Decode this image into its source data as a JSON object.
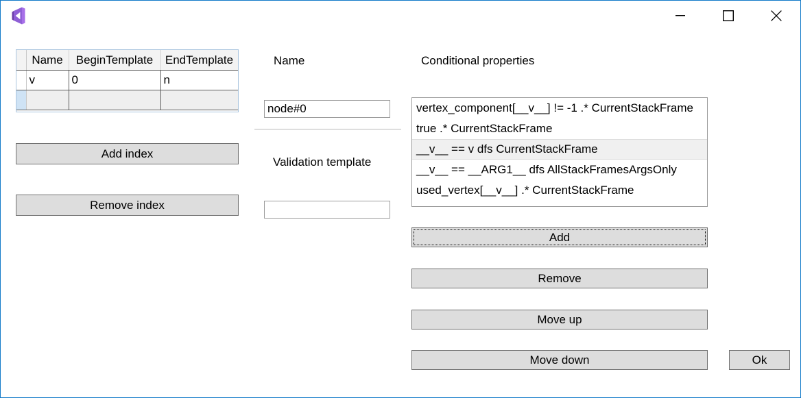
{
  "window": {
    "border_color": "#1279c8",
    "logo_icon": "visual-studio-logo-icon",
    "controls": {
      "minimize_label": "—",
      "maximize_label": "□",
      "close_label": "✕"
    }
  },
  "grid": {
    "columns": [
      "Name",
      "BeginTemplate",
      "EndTemplate"
    ],
    "rows": [
      {
        "cells": [
          "v",
          "0",
          "n"
        ]
      },
      {
        "cells": [
          "",
          "",
          ""
        ]
      }
    ]
  },
  "left_buttons": {
    "add_index": "Add index",
    "remove_index": "Remove index"
  },
  "name_section": {
    "label": "Name",
    "value": "node#0",
    "placeholder": ""
  },
  "validation_section": {
    "label": "Validation template",
    "value": "",
    "placeholder": ""
  },
  "conditional": {
    "label": "Conditional properties",
    "items": [
      "vertex_component[__v__] != -1 .* CurrentStackFrame",
      "true .* CurrentStackFrame",
      "__v__ == v dfs CurrentStackFrame",
      "__v__ == __ARG1__ dfs AllStackFramesArgsOnly",
      "used_vertex[__v__] .* CurrentStackFrame"
    ],
    "selected_index": 2,
    "selection_bg": "#f0f0f0"
  },
  "right_buttons": {
    "add": "Add",
    "remove": "Remove",
    "move_up": "Move up",
    "move_down": "Move down",
    "ok": "Ok"
  }
}
